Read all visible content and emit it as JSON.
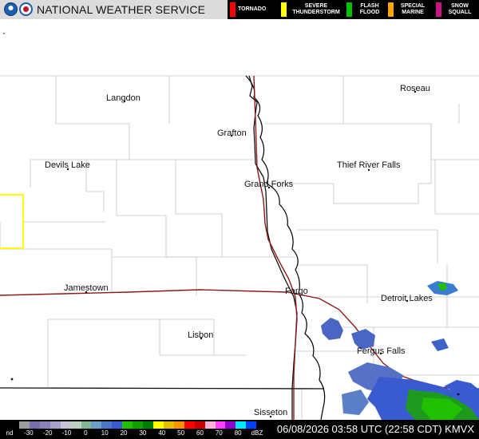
{
  "header": {
    "title": "NATIONAL WEATHER SERVICE",
    "logos": [
      "noaa-logo",
      "nws-logo"
    ]
  },
  "legend": [
    {
      "label": "TORNADO",
      "color": "#ff0000"
    },
    {
      "label": "SEVERE THUNDERSTORM",
      "color": "#ffff00"
    },
    {
      "label": "FLASH FLOOD",
      "color": "#00c000"
    },
    {
      "label": "SPECIAL MARINE",
      "color": "#ffa500"
    },
    {
      "label": "SNOW SQUALL",
      "color": "#c71585"
    }
  ],
  "cities": [
    "Langdon",
    "Roseau",
    "Grafton",
    "Devils Lake",
    "Thief River Falls",
    "Grand Forks",
    "Jamestown",
    "Fargo",
    "Detroit Lakes",
    "Lisbon",
    "Fergus Falls",
    "Sisseton"
  ],
  "colorbar": {
    "ticks": [
      "nd",
      "-30",
      "-20",
      "-10",
      "0",
      "10",
      "20",
      "30",
      "40",
      "50",
      "60",
      "70",
      "80",
      "dBZ"
    ],
    "colors": [
      "#9c9c9c",
      "#7a6ea8",
      "#8a82b6",
      "#a8a2c8",
      "#c8c4d8",
      "#bcd0c0",
      "#86b496",
      "#6aa0c8",
      "#4a78c8",
      "#3a5ad0",
      "#20c000",
      "#10a000",
      "#008000",
      "#ffff00",
      "#e6c000",
      "#ff9000",
      "#ff0000",
      "#c80000",
      "#ffb0d8",
      "#ff40ff",
      "#9000d0",
      "#00e8ff",
      "#0040ff",
      "#000000"
    ]
  },
  "timestamp": "06/08/2026 03:58 UTC (22:58 CDT) KMVX"
}
